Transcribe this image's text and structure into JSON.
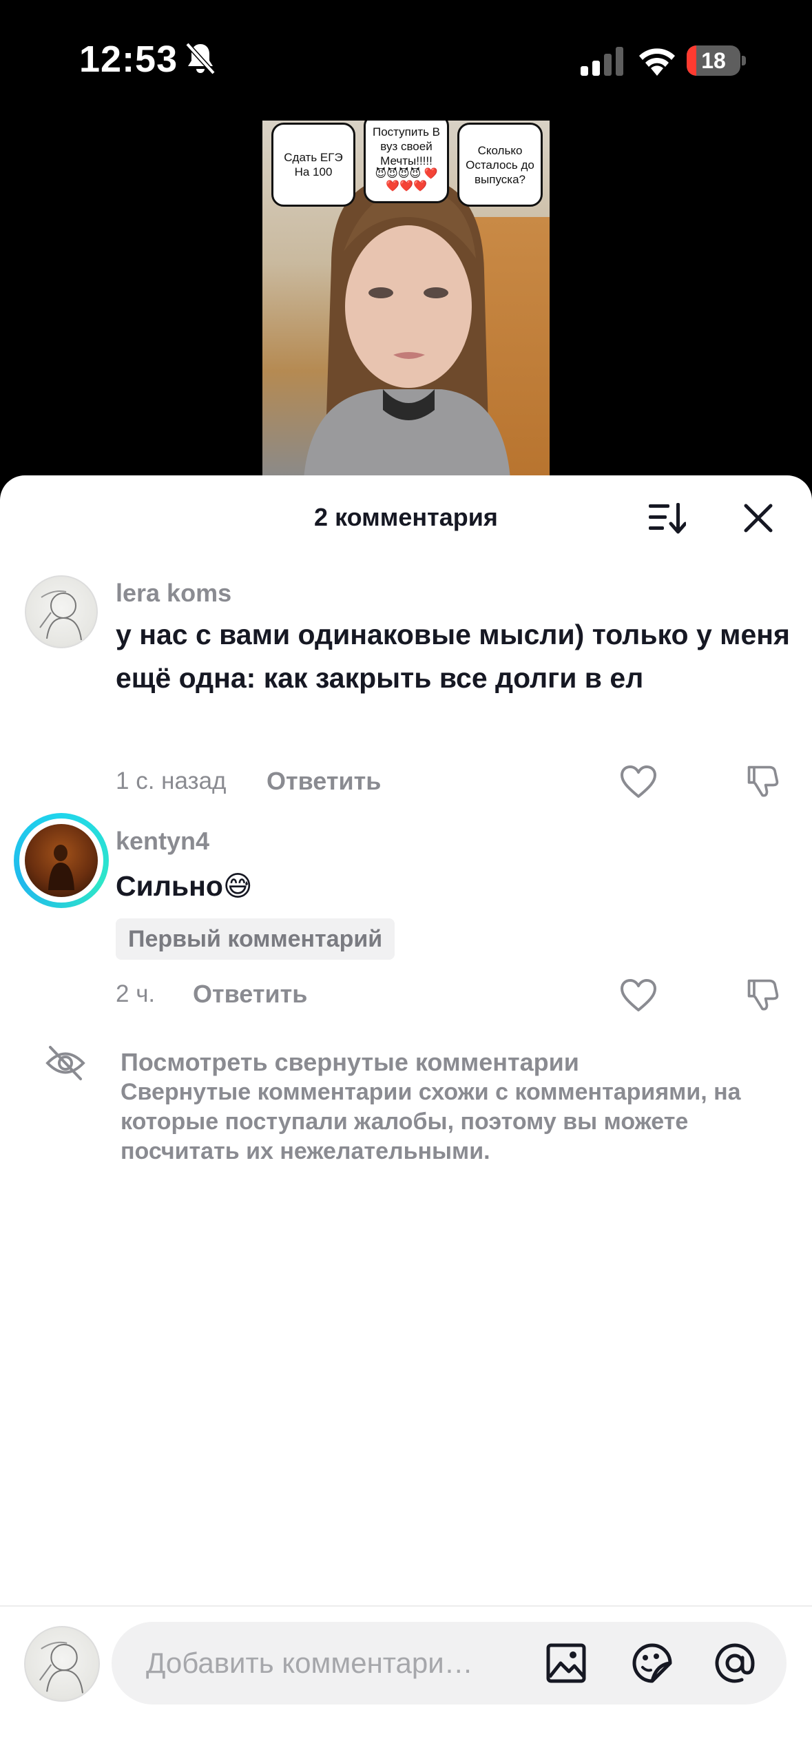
{
  "status_bar": {
    "time": "12:53",
    "battery_level": "18",
    "battery_fraction": 0.18,
    "icons": [
      "bell-off-icon",
      "cellular-signal-icon",
      "wifi-icon",
      "battery-icon"
    ]
  },
  "video": {
    "stickers": [
      {
        "text": "Сдать ЕГЭ На 100"
      },
      {
        "text": "Поступить В вуз своей Мечты!!!!!",
        "hearts": "😈😈😈😈 ❤️❤️❤️❤️"
      },
      {
        "text": "Сколько Осталось до выпуска?"
      }
    ]
  },
  "sheet": {
    "title": "2 комментария",
    "icons": [
      "sort-icon",
      "close-icon"
    ]
  },
  "comments": [
    {
      "username": "lera koms",
      "text": "у нас с вами одинаковые мысли) только у меня ещё одна: как закрыть все долги в ел",
      "time": "1 с. назад",
      "reply_label": "Ответить"
    },
    {
      "username": "kentyn4",
      "text": "Сильно😅",
      "badge": "Первый комментарий",
      "time": "2 ч.",
      "reply_label": "Ответить"
    }
  ],
  "collapsed": {
    "title": "Посмотреть свернутые комментарии",
    "description": "Свернутые комментарии схожи с комментариями, на которые поступали жалобы, поэтому вы можете посчитать их нежелательными."
  },
  "input": {
    "placeholder": "Добавить комментари…",
    "icons": [
      "image-icon",
      "emoji-sticker-icon",
      "mention-icon"
    ]
  },
  "colors": {
    "primary_text": "#161823",
    "secondary_text": "#8a8b91",
    "story_ring": "#20d5ec",
    "battery_low": "#ff3b30"
  }
}
